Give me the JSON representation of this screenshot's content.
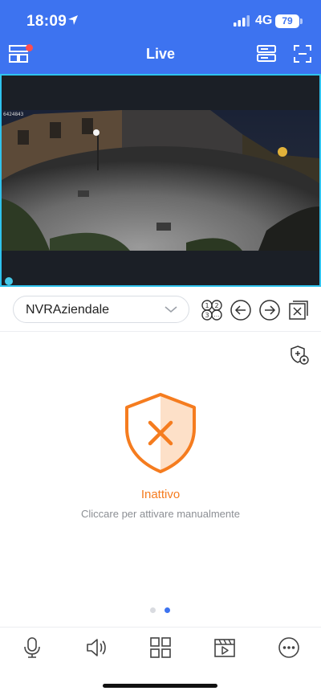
{
  "status_bar": {
    "time": "18:09",
    "network": "4G",
    "battery": "79"
  },
  "header": {
    "title": "Live",
    "left_icon": "multi-view-layout-icon",
    "right_icons": [
      "device-list-icon",
      "fullscreen-icon"
    ],
    "colors": {
      "background": "#3d73f0",
      "badge": "#ff4d4f"
    }
  },
  "video": {
    "camera_label": "6424843",
    "accent": "#2fc3ee"
  },
  "controls": {
    "device_name": "NVRAziendale",
    "icons": [
      "channel-numbers-icon",
      "previous-arrow-icon",
      "next-arrow-icon",
      "close-channel-icon"
    ]
  },
  "alarm": {
    "settings_icon": "shield-settings-icon",
    "shield_icon": "shield-x-icon",
    "status": "Inattivo",
    "hint": "Cliccare per attivare manualmente",
    "accent": "#f57c1f"
  },
  "pager": {
    "count": 2,
    "active": 2
  },
  "bottom_bar": {
    "icons": [
      "microphone-icon",
      "speaker-icon",
      "grid-icon",
      "clapperboard-icon",
      "more-icon"
    ]
  }
}
